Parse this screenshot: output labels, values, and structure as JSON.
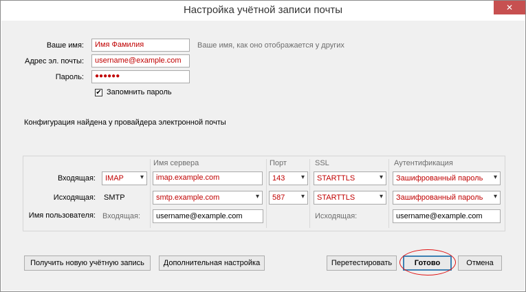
{
  "window": {
    "title": "Настройка учётной записи почты",
    "close_symbol": "✕"
  },
  "identity": {
    "name_label": "Ваше имя:",
    "name_value": "Имя Фамилия",
    "name_hint": "Ваше имя, как оно отображается у других",
    "email_label": "Адрес эл. почты:",
    "email_value": "username@example.com",
    "password_label": "Пароль:",
    "password_value": "●●●●●●",
    "remember_label": "Запомнить пароль",
    "remember_checked": true
  },
  "status": "Конфигурация найдена у провайдера электронной почты",
  "server_table": {
    "headers": {
      "server": "Имя сервера",
      "port": "Порт",
      "ssl": "SSL",
      "auth": "Аутентификация"
    },
    "incoming": {
      "label": "Входящая:",
      "protocol": "IMAP",
      "server": "imap.example.com",
      "port": "143",
      "ssl": "STARTTLS",
      "auth": "Зашифрованный пароль"
    },
    "outgoing": {
      "label": "Исходящая:",
      "protocol": "SMTP",
      "server": "smtp.example.com",
      "port": "587",
      "ssl": "STARTTLS",
      "auth": "Зашифрованный пароль"
    },
    "username": {
      "label": "Имя пользователя:",
      "incoming_label": "Входящая:",
      "incoming_value": "username@example.com",
      "outgoing_label": "Исходящая:",
      "outgoing_value": "username@example.com"
    }
  },
  "buttons": {
    "new_account": "Получить новую учётную запись",
    "advanced": "Дополнительная настройка",
    "retest": "Перетестировать",
    "done": "Готово",
    "cancel": "Отмена"
  },
  "colors": {
    "accent_red": "#c00000",
    "close_red": "#c75050",
    "highlight_circle": "#e01010"
  }
}
